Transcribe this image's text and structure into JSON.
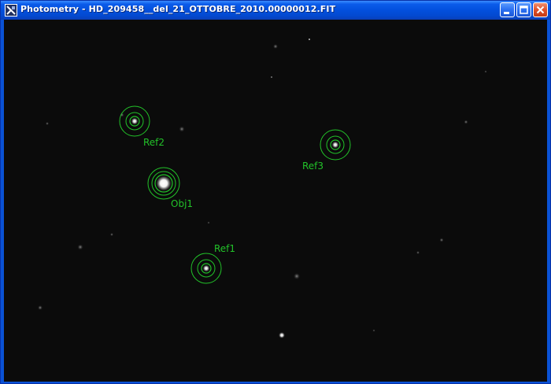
{
  "window": {
    "title": "Photometry - HD_209458__del_21_OTTOBRE_2010.00000012.FIT",
    "icons": {
      "app": "photometry-app-icon",
      "minimize": "minimize-icon",
      "maximize": "maximize-icon",
      "close": "close-icon"
    }
  },
  "colors": {
    "title_bar": "#0a5bea",
    "aperture_green": "#22c229",
    "sky_background": "#0b0b0b"
  },
  "apertures": [
    {
      "label": "Obj1"
    },
    {
      "label": "Ref1"
    },
    {
      "label": "Ref2"
    },
    {
      "label": "Ref3"
    }
  ]
}
